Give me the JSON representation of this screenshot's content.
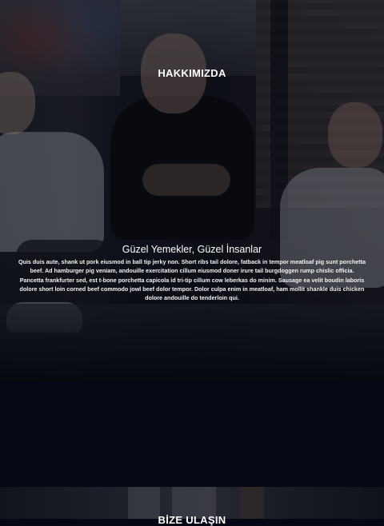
{
  "about": {
    "section_title": "HAKKIMIZDA",
    "headline": "Güzel Yemekler, Güzel İnsanlar",
    "body": "Quis duis aute, shank ut pork eiusmod in ball tip jerky non. Short ribs tail dolore, fatback in tempor meatloaf pig sunt porchetta beef. Ad hamburger pig veniam, andouille exercitation cillum eiusmod doner irure tail burgdoggen rump chislic officia. Pancetta frankfurter sed, est t-bone porchetta capicola id tri-tip cillum cow leberkas do minim. Sausage ea velit boudin laboris dolore short loin corned beef commodo jowl beef dolor tempor. Dolor culpa enim in meatloaf, ham mollit shankle duis chicken dolore andouille do tenderloin qui."
  },
  "contact": {
    "section_title": "BİZE ULAŞIN"
  }
}
